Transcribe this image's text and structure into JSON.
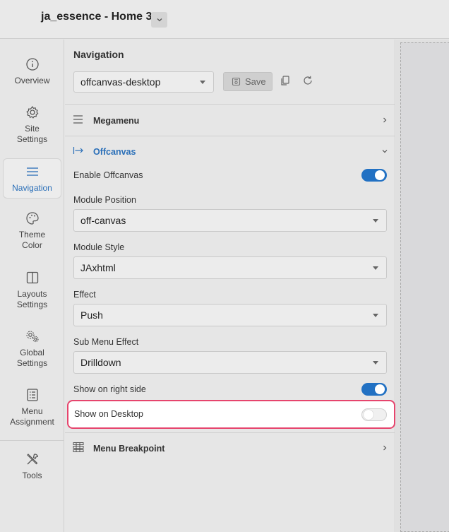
{
  "header": {
    "title": "ja_essence - Home 3"
  },
  "sidebar": {
    "items": [
      {
        "label": "Overview",
        "icon": "info-icon"
      },
      {
        "label": "Site Settings",
        "icon": "gear-icon"
      },
      {
        "label": "Navigation",
        "icon": "menu-icon",
        "active": true
      },
      {
        "label": "Theme Color",
        "icon": "palette-icon"
      },
      {
        "label": "Layouts Settings",
        "icon": "layout-icon"
      },
      {
        "label": "Global Settings",
        "icon": "gears-icon"
      },
      {
        "label": "Menu Assignment",
        "icon": "list-icon"
      },
      {
        "label": "Tools",
        "icon": "tools-icon"
      }
    ]
  },
  "panel": {
    "title": "Navigation",
    "menu_select": "offcanvas-desktop",
    "save_label": "Save",
    "sections": {
      "megamenu": "Megamenu",
      "offcanvas": "Offcanvas",
      "breakpoint": "Menu Breakpoint"
    },
    "fields": {
      "enable_offcanvas": {
        "label": "Enable Offcanvas",
        "on": true
      },
      "module_position": {
        "label": "Module Position",
        "value": "off-canvas"
      },
      "module_style": {
        "label": "Module Style",
        "value": "JAxhtml"
      },
      "effect": {
        "label": "Effect",
        "value": "Push"
      },
      "sub_menu_effect": {
        "label": "Sub Menu Effect",
        "value": "Drilldown"
      },
      "right_side": {
        "label": "Show on right side",
        "on": true
      },
      "desktop": {
        "label": "Show on Desktop",
        "on": false
      }
    }
  },
  "colors": {
    "accent": "#2271c3",
    "highlight": "#e6456d"
  }
}
